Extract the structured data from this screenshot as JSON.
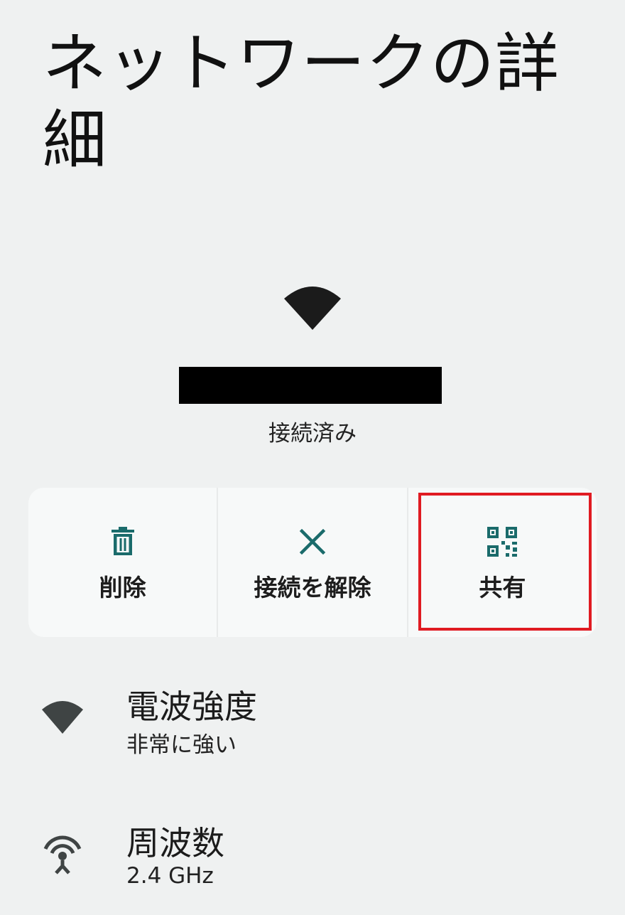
{
  "page": {
    "title": "ネットワークの詳細"
  },
  "network": {
    "status": "接続済み"
  },
  "actions": [
    {
      "label": "削除",
      "icon": "trash-icon"
    },
    {
      "label": "接続を解除",
      "icon": "close-icon"
    },
    {
      "label": "共有",
      "icon": "qr-code-icon"
    }
  ],
  "details": [
    {
      "title": "電波強度",
      "value": "非常に強い",
      "icon": "wifi-signal-icon"
    },
    {
      "title": "周波数",
      "value": "2.4 GHz",
      "icon": "antenna-icon"
    }
  ],
  "colors": {
    "background": "#eff1f1",
    "card": "#f7f9f9",
    "accent": "#1a6b6b",
    "highlight": "#e01b22"
  }
}
